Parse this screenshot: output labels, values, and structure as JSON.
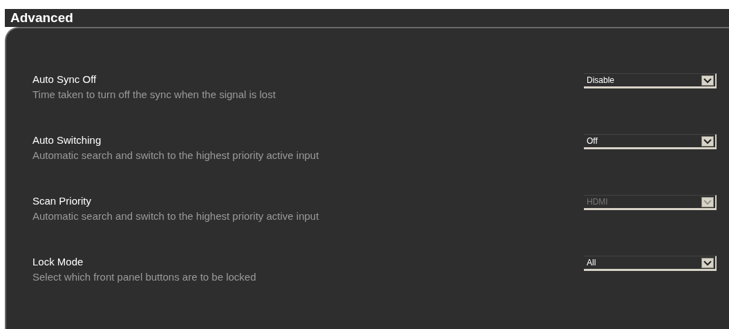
{
  "section": {
    "title": "Advanced"
  },
  "settings": [
    {
      "name": "Auto Sync Off",
      "description": "Time taken to turn off the sync when the signal is lost",
      "value": "Disable",
      "disabled": false
    },
    {
      "name": "Auto Switching",
      "description": "Automatic search and switch to the highest priority active input",
      "value": "Off",
      "disabled": false
    },
    {
      "name": "Scan Priority",
      "description": "Automatic search and switch to the highest priority active input",
      "value": "HDMI",
      "disabled": true
    },
    {
      "name": "Lock Mode",
      "description": "Select which front panel buttons are to be locked",
      "value": "All",
      "disabled": false
    }
  ]
}
